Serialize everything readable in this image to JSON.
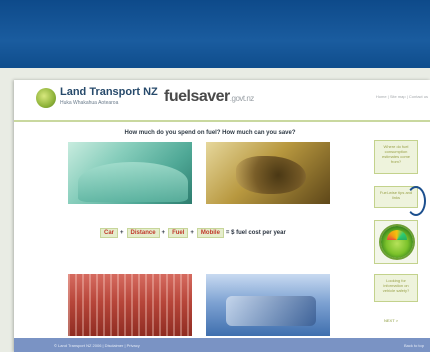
{
  "header": {
    "lt_name": "Land Transport NZ",
    "lt_sub": "Huka Whakahua Aotearoa",
    "fs_name": "fuelsaver",
    "fs_suffix": ".govt.nz",
    "top_links": "Home | Site map | Contact us"
  },
  "main": {
    "headline": "How much do you spend on fuel? How much can you save?",
    "nav": [
      "Car",
      "Distance",
      "Fuel",
      "Mobile"
    ],
    "nav_separator": "+",
    "nav_tail": "= $ fuel cost per year"
  },
  "sidebar": {
    "btn1": "Where do fuel consumption estimates come from?",
    "btn2": "Fuel-wise tips and links",
    "btn4": "Looking for information on vehicle safety?",
    "next": "NEXT >"
  },
  "footer": {
    "left": "© Land Transport NZ 2006 | Disclaimer | Privacy",
    "right": "Back to top"
  },
  "colors": {
    "top_band": "#1a5c9f",
    "footer": "#7a93c4",
    "accent_green": "#c3d28c"
  }
}
